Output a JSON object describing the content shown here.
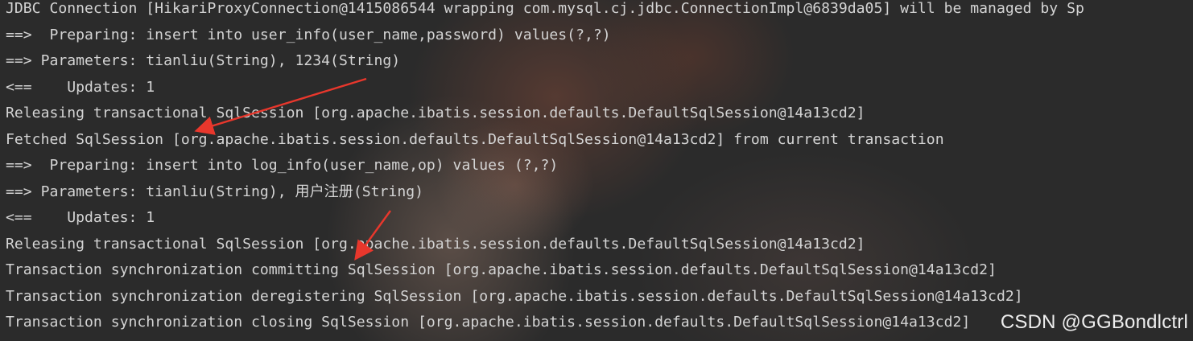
{
  "console": {
    "lines": [
      "JDBC Connection [HikariProxyConnection@1415086544 wrapping com.mysql.cj.jdbc.ConnectionImpl@6839da05] will be managed by Sp",
      "==>  Preparing: insert into user_info(user_name,password) values(?,?)",
      "==> Parameters: tianliu(String), 1234(String)",
      "<==    Updates: 1",
      "Releasing transactional SqlSession [org.apache.ibatis.session.defaults.DefaultSqlSession@14a13cd2]",
      "Fetched SqlSession [org.apache.ibatis.session.defaults.DefaultSqlSession@14a13cd2] from current transaction",
      "==>  Preparing: insert into log_info(user_name,op) values (?,?)",
      "==> Parameters: tianliu(String), 用户注册(String)",
      "<==    Updates: 1",
      "Releasing transactional SqlSession [org.apache.ibatis.session.defaults.DefaultSqlSession@14a13cd2]",
      "Transaction synchronization committing SqlSession [org.apache.ibatis.session.defaults.DefaultSqlSession@14a13cd2]",
      "Transaction synchronization deregistering SqlSession [org.apache.ibatis.session.defaults.DefaultSqlSession@14a13cd2]",
      "Transaction synchronization closing SqlSession [org.apache.ibatis.session.defaults.DefaultSqlSession@14a13cd2]"
    ]
  },
  "annotations": {
    "arrow_color": "#e8372c"
  },
  "watermark": "CSDN @GGBondlctrl"
}
